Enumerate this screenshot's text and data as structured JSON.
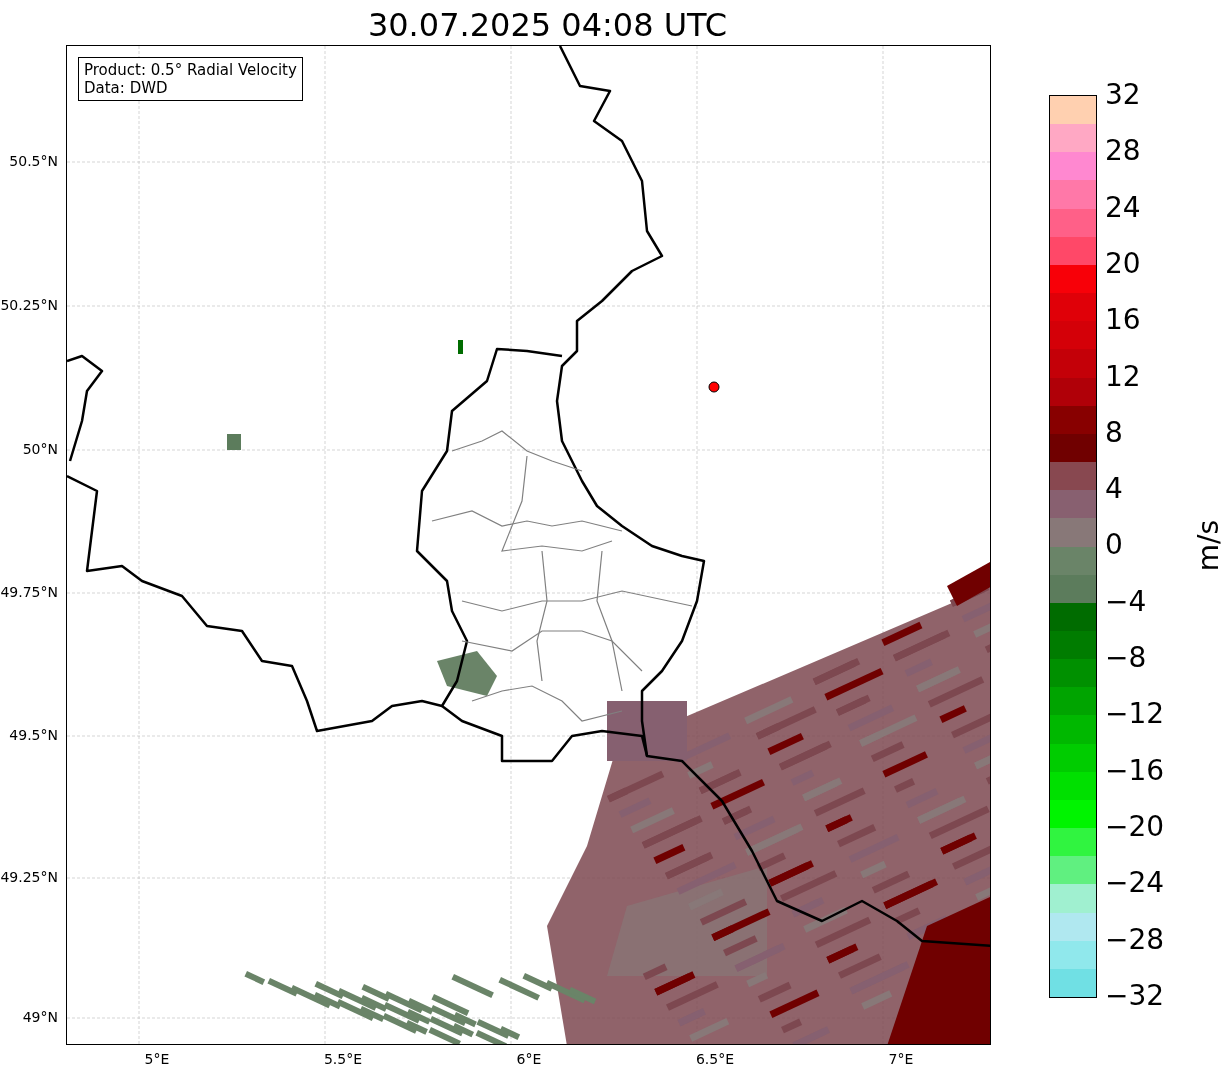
{
  "title": "30.07.2025 04:08 UTC",
  "info_box": [
    "Product: 0.5° Radial Velocity",
    "Data: DWD"
  ],
  "y_ticks": [
    "50.5°N",
    "50.25°N",
    "50°N",
    "49.75°N",
    "49.5°N",
    "49.25°N",
    "49°N"
  ],
  "x_ticks": [
    "5°E",
    "5.5°E",
    "6°E",
    "6.5°E",
    "7°E"
  ],
  "colorbar": {
    "label": "m/s",
    "ticks": [
      "32",
      "28",
      "24",
      "20",
      "16",
      "12",
      "8",
      "4",
      "0",
      "−4",
      "−8",
      "−12",
      "−16",
      "−20",
      "−24",
      "−28",
      "−32"
    ],
    "bands": [
      {
        "color": "#ffd0b0"
      },
      {
        "color": "#ffa8c4"
      },
      {
        "color": "#ff88d0"
      },
      {
        "color": "#ff78a8"
      },
      {
        "color": "#ff6088"
      },
      {
        "color": "#ff4868"
      },
      {
        "color": "#f80008"
      },
      {
        "color": "#e00008"
      },
      {
        "color": "#d40008"
      },
      {
        "color": "#c40008"
      },
      {
        "color": "#b00008"
      },
      {
        "color": "#880000"
      },
      {
        "color": "#700000"
      },
      {
        "color": "#884850"
      },
      {
        "color": "#886070"
      },
      {
        "color": "#887878"
      },
      {
        "color": "#6a8468"
      },
      {
        "color": "#5c7c5c"
      },
      {
        "color": "#006c00"
      },
      {
        "color": "#007c00"
      },
      {
        "color": "#009000"
      },
      {
        "color": "#00a400"
      },
      {
        "color": "#00b800"
      },
      {
        "color": "#00cc00"
      },
      {
        "color": "#00e000"
      },
      {
        "color": "#00f400"
      },
      {
        "color": "#30f440"
      },
      {
        "color": "#60f080"
      },
      {
        "color": "#a0f0d0"
      },
      {
        "color": "#b0e8f0"
      },
      {
        "color": "#90e8ec"
      },
      {
        "color": "#70e0e4"
      }
    ]
  }
}
